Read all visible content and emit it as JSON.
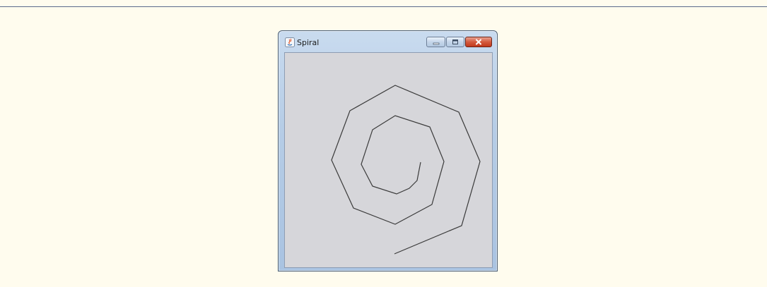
{
  "window": {
    "title": "Spiral",
    "controls": {
      "minimize_icon": "minimize-icon",
      "maximize_icon": "maximize-icon",
      "close_icon": "close-icon"
    }
  },
  "colors": {
    "page_background": "#fffcee",
    "canvas_background": "#d6d6da",
    "spiral_stroke": "#3a3a3a"
  }
}
